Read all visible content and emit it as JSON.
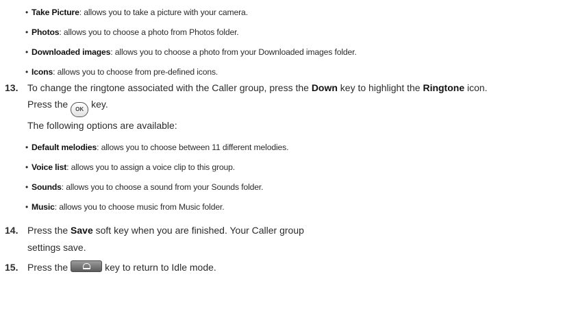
{
  "picture_options": [
    {
      "title": "Take Picture",
      "desc": ": allows you to take a picture with your camera."
    },
    {
      "title": "Photos",
      "desc": ": allows you to choose a photo from Photos folder."
    },
    {
      "title": "Downloaded images",
      "desc": ": allows you to choose a photo from your Downloaded images folder."
    },
    {
      "title": "Icons",
      "desc": ": allows you to choose from pre-defined icons."
    }
  ],
  "step13": {
    "num": "13.",
    "t1": "To change the ringtone associated with the Caller group, press the ",
    "k1": "Down",
    "t2": " key to highlight the ",
    "k2": "Ringtone",
    "t3": " icon.",
    "t4": "Press the",
    "ok_label": "OK",
    "t5": "key.",
    "available": "The following options are available:"
  },
  "ringtone_options": [
    {
      "title": "Default melodies",
      "desc": ": allows you to choose between 11 different melodies."
    },
    {
      "title": "Voice list",
      "desc": ": allows you to assign a voice clip to this group."
    },
    {
      "title": "Sounds",
      "desc": ": allows you to choose a sound from your Sounds folder."
    },
    {
      "title": "Music",
      "desc": ": allows you to choose music from Music folder."
    }
  ],
  "step14": {
    "num": "14.",
    "t1": "Press the ",
    "k1": "Save",
    "t2": " soft key when you are finished. Your Caller group",
    "t3": "settings save."
  },
  "step15": {
    "num": "15.",
    "t1": "Press the",
    "t2": "key to return to Idle mode."
  },
  "icons": {
    "ok_key": "ok-key-icon",
    "end_key": "end-key-icon"
  }
}
